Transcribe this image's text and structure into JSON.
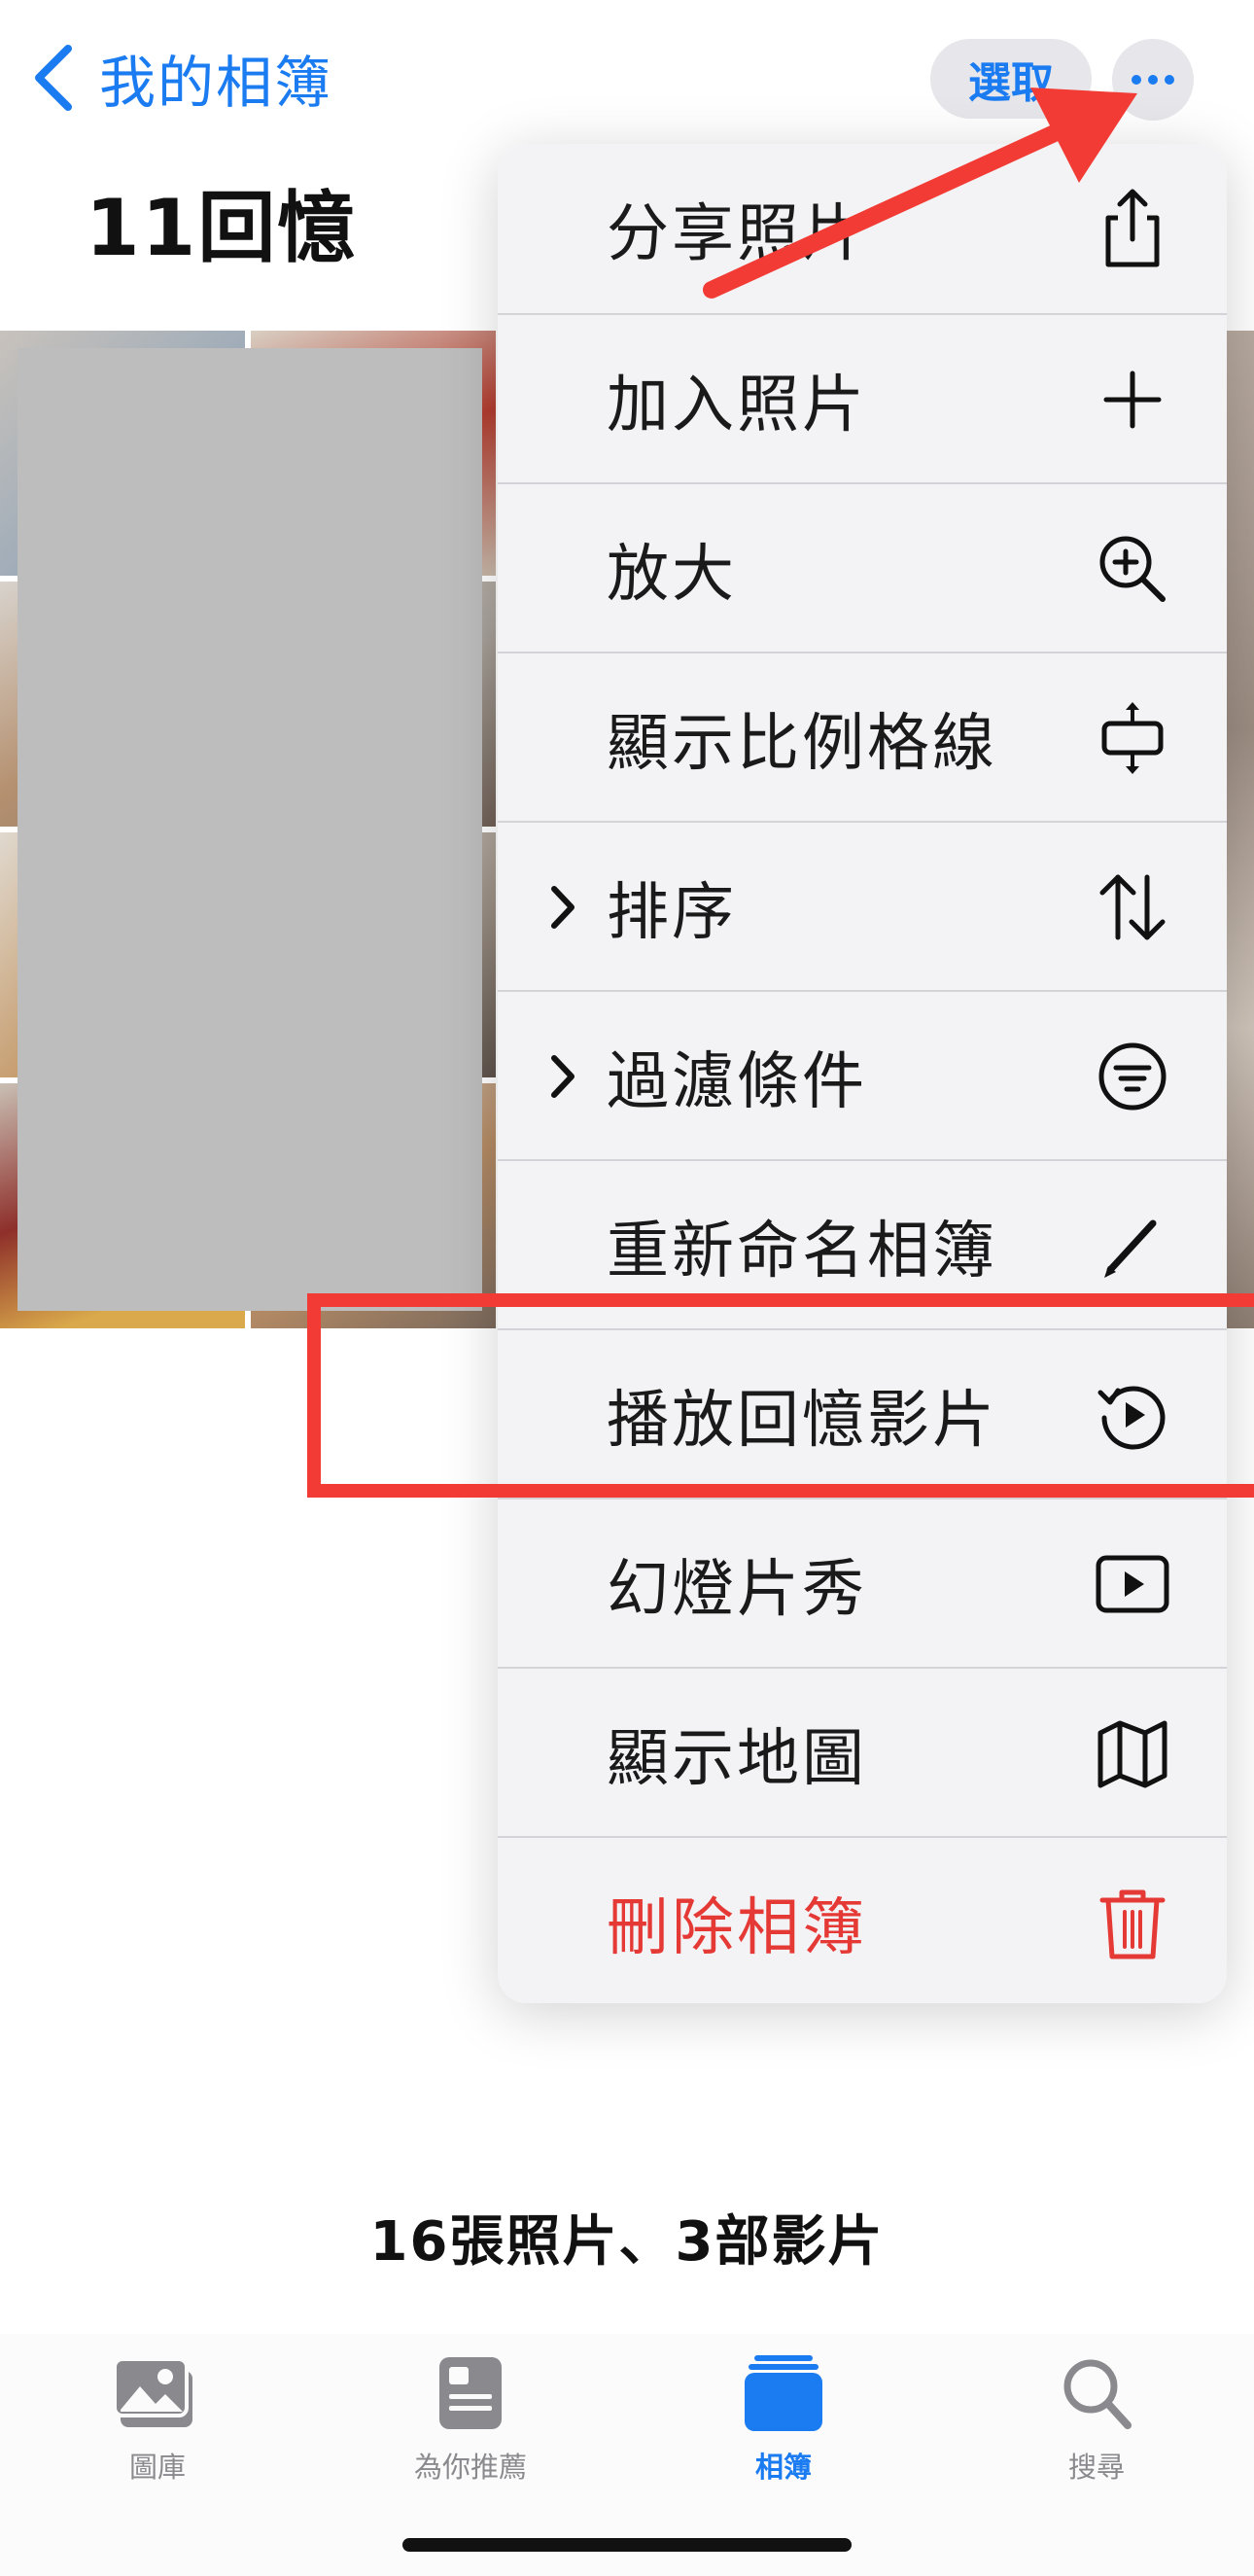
{
  "nav": {
    "back_label": "我的相簿",
    "select_label": "選取"
  },
  "album": {
    "title": "11回憶",
    "summary": "16張照片、3部影片"
  },
  "menu": {
    "items": [
      {
        "label": "分享照片",
        "icon": "share-icon",
        "has_submenu": false
      },
      {
        "label": "加入照片",
        "icon": "plus-icon",
        "has_submenu": false
      },
      {
        "label": "放大",
        "icon": "zoom-in-icon",
        "has_submenu": false
      },
      {
        "label": "顯示比例格線",
        "icon": "aspect-ratio-icon",
        "has_submenu": false
      },
      {
        "label": "排序",
        "icon": "sort-arrows-icon",
        "has_submenu": true
      },
      {
        "label": "過濾條件",
        "icon": "filter-icon",
        "has_submenu": true
      },
      {
        "label": "重新命名相簿",
        "icon": "pencil-icon",
        "has_submenu": false
      },
      {
        "label": "播放回憶影片",
        "icon": "memory-play-icon",
        "has_submenu": false
      },
      {
        "label": "幻燈片秀",
        "icon": "slideshow-play-icon",
        "has_submenu": false
      },
      {
        "label": "顯示地圖",
        "icon": "map-icon",
        "has_submenu": false
      },
      {
        "label": "刪除相簿",
        "icon": "trash-icon",
        "has_submenu": false,
        "destructive": true
      }
    ]
  },
  "tabs": [
    {
      "label": "圖庫",
      "icon": "photos-library-icon",
      "active": false
    },
    {
      "label": "為你推薦",
      "icon": "for-you-icon",
      "active": false
    },
    {
      "label": "相簿",
      "icon": "albums-icon",
      "active": true
    },
    {
      "label": "搜尋",
      "icon": "search-icon",
      "active": false
    }
  ],
  "colors": {
    "accent": "#1b7cf2",
    "destructive": "#e53935",
    "annotation": "#f23b35"
  }
}
